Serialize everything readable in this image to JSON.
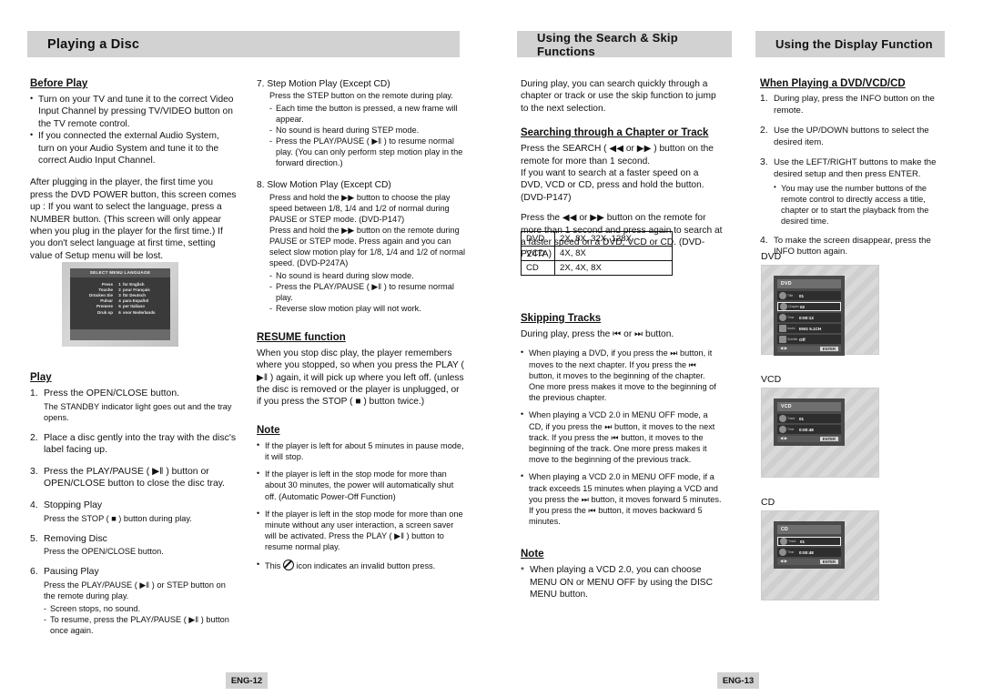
{
  "document": {
    "type": "dvd-player-user-manual-spread"
  },
  "sections": {
    "left_title": "Playing a Disc",
    "mid_title": "Using the Search & Skip Functions",
    "right_title": "Using the Display Function"
  },
  "col1": {
    "before_play_head": "Before Play",
    "before_play_bullets": [
      "Turn on your TV and tune it to the correct Video Input Channel by pressing TV/VIDEO button on the TV remote control.",
      "If you connected the external Audio System, turn on your Audio System and tune it to the correct Audio Input Channel."
    ],
    "first_time_paragraph": "After plugging in the player, the first time you press the DVD POWER button, this screen comes up : If you want to select the language, press a NUMBER button. (This screen will only appear when you plug in the player for the first time.) If you don't select language at first time, setting value of Setup menu will be lost.",
    "tv_screen": {
      "title": "SELECT MENU LANGUAGE",
      "rows": [
        {
          "verb": "Press",
          "number": "1",
          "language": "for English"
        },
        {
          "verb": "Touche",
          "number": "2",
          "language": "pour Français"
        },
        {
          "verb": "Drücken Sie",
          "number": "3",
          "language": "für Deutsch"
        },
        {
          "verb": "Pulsar",
          "number": "4",
          "language": "para Español"
        },
        {
          "verb": "Premere",
          "number": "5",
          "language": "per Italiano"
        },
        {
          "verb": "Druk op",
          "number": "6",
          "language": "voor Nederlands"
        }
      ]
    },
    "play_head": "Play",
    "play_steps": [
      {
        "main": "Press the OPEN/CLOSE button.",
        "sub": "The STANDBY indicator light goes out and the tray opens."
      },
      {
        "main": "Place a disc gently into the tray with the disc's label facing up.",
        "sub": ""
      },
      {
        "main": "Press the PLAY/PAUSE ( ▶‖ ) button or OPEN/CLOSE button to close the disc tray.",
        "sub": ""
      },
      {
        "main": "Stopping Play",
        "sub": "Press the STOP ( ■ ) button during play."
      },
      {
        "main": "Removing Disc",
        "sub": "Press the OPEN/CLOSE button."
      },
      {
        "main": "Pausing Play",
        "sub": "Press the PLAY/PAUSE ( ▶‖ ) or STEP button on the remote during play."
      }
    ],
    "pausing_dashes": [
      "Screen stops, no sound.",
      "To resume, press the PLAY/PAUSE ( ▶‖ ) button once again."
    ]
  },
  "col2": {
    "step7_title": "7. Step Motion Play (Except CD)",
    "step7_lead": "Press the STEP button on the remote during play.",
    "step7_dashes": [
      "Each time the button is pressed, a new frame will appear.",
      "No sound is heard during STEP mode.",
      "Press the PLAY/PAUSE ( ▶‖ ) to resume normal play. (You can only perform step motion play in the forward direction.)"
    ],
    "step8_title": "8. Slow Motion Play (Except CD)",
    "step8_p1": "Press and hold the ▶▶ button to choose the play speed between 1/8, 1/4 and 1/2 of normal during PAUSE or STEP mode. (DVD-P147)",
    "step8_p2": "Press and hold the ▶▶ button on the remote during PAUSE or STEP mode. Press again and you can select slow motion play for 1/8, 1/4 and 1/2 of normal speed. (DVD-P247A)",
    "step8_dashes": [
      "No sound is heard during slow mode.",
      "Press the PLAY/PAUSE ( ▶‖ ) to resume normal play.",
      "Reverse slow motion play will not work."
    ],
    "resume_head": "RESUME function",
    "resume_body": "When you stop disc play, the player remembers where you stopped, so when you press the PLAY ( ▶‖ ) again, it will pick up where you left off. (unless the disc is removed or the player is unplugged, or if you press the STOP ( ■ ) button twice.)",
    "note_head": "Note",
    "note_bullets": [
      "If the player is left for about 5 minutes in pause mode, it will stop.",
      "If the player is left in the stop mode for more than about 30 minutes, the power will automatically shut off. (Automatic Power-Off Function)",
      "If the player is left in the stop mode for more than one minute without any user interaction, a screen saver will be activated. Press the PLAY ( ▶‖ ) button to resume normal play."
    ],
    "invalid_note_prefix": "This",
    "invalid_note_suffix": "icon indicates an invalid button press."
  },
  "col3": {
    "intro": "During play, you can search quickly through a chapter or track or use the skip function to jump to the next selection.",
    "search_head": "Searching through a Chapter or Track",
    "search_p1": "Press the SEARCH ( ◀◀ or ▶▶ ) button on the remote for more than 1 second.",
    "search_p2": "If you want to search at a faster speed on a DVD, VCD or CD, press and hold the button. (DVD-P147)",
    "search_p3": "Press the ◀◀ or ▶▶ button on the remote for more than 1 second and press again to search at a faster speed on a DVD, VCD or CD. (DVD-P247A)",
    "speed_table": {
      "rows": [
        {
          "disc": "DVD",
          "speeds": "2X, 8X, 32X, 128X"
        },
        {
          "disc": "VCD",
          "speeds": "4X, 8X"
        },
        {
          "disc": "CD",
          "speeds": "2X, 4X, 8X"
        }
      ]
    },
    "skip_head": "Skipping Tracks",
    "skip_lead": "During play, press the ⏮ or ⏭ button.",
    "skip_bullets": [
      "When playing a DVD, if you press the ⏭ button, it moves to the next chapter. If you press the ⏮ button, it moves to the beginning of the chapter. One more press makes it move to the beginning of the previous chapter.",
      "When playing a VCD 2.0 in MENU OFF mode, a CD, if you press the ⏭ button, it moves to the next track. If you press the ⏮ button, it moves to the beginning of the track. One more press makes it move to the beginning of the previous track.",
      "When playing a VCD 2.0 in MENU OFF mode, if a track exceeds 15 minutes when playing a VCD and you press the ⏭ button, it moves forward 5 minutes. If you press the ⏮ button, it moves backward 5 minutes."
    ],
    "note_head": "Note",
    "note_star": "When playing a VCD 2.0, you can choose MENU ON or MENU OFF by using the DISC MENU button."
  },
  "col4": {
    "head": "When Playing a DVD/VCD/CD",
    "steps": [
      "During play, press the INFO button on the remote.",
      "Use the UP/DOWN buttons to select the desired item.",
      "Use the LEFT/RIGHT buttons to make the desired setup and then press ENTER.",
      "To make the screen disappear, press the INFO button again."
    ],
    "step3_sub": "You may use the number buttons of the remote control to directly access a title, chapter or to start the playback from the desired time.",
    "osd": [
      {
        "label": "DVD",
        "header": "DVD",
        "rows": [
          {
            "icon": "title-icon",
            "name": "Title",
            "value": "01",
            "selected": false
          },
          {
            "icon": "chapter-icon",
            "name": "Chapter",
            "value": "02",
            "selected": true
          },
          {
            "icon": "time-icon",
            "name": "Time",
            "value": "0:00:13",
            "selected": false
          },
          {
            "icon": "audio-icon",
            "name": "Audio",
            "value": "ENG 5.1CH",
            "selected": false
          },
          {
            "icon": "subtitle-icon",
            "name": "Subtitle",
            "value": "Off",
            "selected": false
          }
        ],
        "foot_arrows": "◀ ▶",
        "foot_enter": "ENTER"
      },
      {
        "label": "VCD",
        "header": "VCD",
        "rows": [
          {
            "icon": "track-icon",
            "name": "Track",
            "value": "01",
            "selected": false
          },
          {
            "icon": "time-icon",
            "name": "Time",
            "value": "0:00:48",
            "selected": false
          }
        ],
        "foot_arrows": "◀ ▶",
        "foot_enter": "ENTER"
      },
      {
        "label": "CD",
        "header": "CD",
        "rows": [
          {
            "icon": "track-icon",
            "name": "Track",
            "value": "01",
            "selected": true
          },
          {
            "icon": "time-icon",
            "name": "Time",
            "value": "0:00:48",
            "selected": false
          }
        ],
        "foot_arrows": "◀ ▶",
        "foot_enter": "ENTER"
      }
    ]
  },
  "footer": {
    "left_page": "ENG-12",
    "right_page": "ENG-13"
  }
}
